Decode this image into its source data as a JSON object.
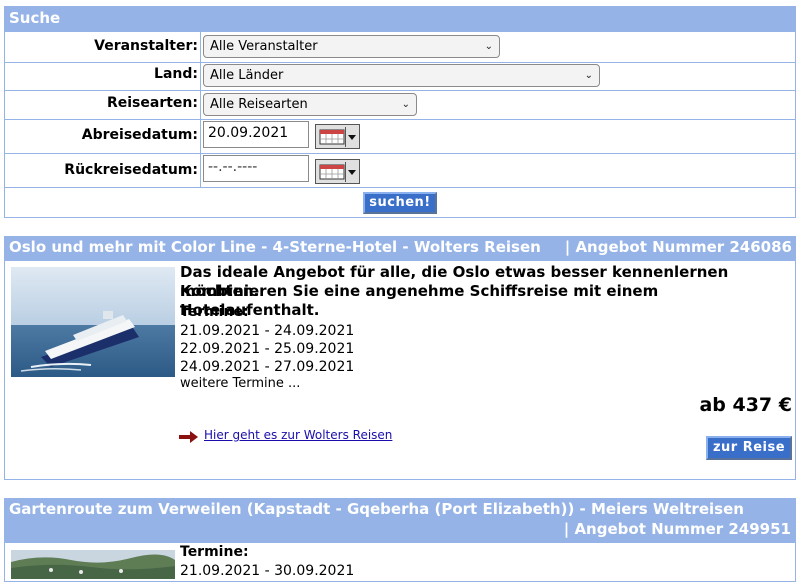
{
  "search": {
    "header": "Suche",
    "veranstalter_label": "Veranstalter:",
    "veranstalter_value": "Alle Veranstalter",
    "land_label": "Land:",
    "land_value": "Alle Länder",
    "reisearten_label": "Reisearten:",
    "reisearten_value": "Alle Reisearten",
    "abreise_label": "Abreisedatum:",
    "abreise_value": "20.09.2021",
    "rueckreise_label": "Rückreisedatum:",
    "rueckreise_value": "--.--.----",
    "submit_label": "suchen!"
  },
  "offers": [
    {
      "title": "Oslo und mehr mit Color Line - 4-Sterne-Hotel - Wolters Reisen",
      "number": "| Angebot Nummer 246086",
      "description_1": "Das ideale Angebot für alle, die Oslo etwas besser kennenlernen möchten.",
      "description_2": "Kombinieren Sie eine angenehme Schiffsreise mit einem Hotelaufenthalt.",
      "termine_label": "Termine:",
      "dates": [
        "21.09.2021 - 24.09.2021",
        "22.09.2021 - 25.09.2021",
        "24.09.2021 - 27.09.2021"
      ],
      "more_dates": "weitere Termine ...",
      "price": "ab 437 €",
      "link_text": "Hier geht es zur Wolters Reisen",
      "button_label": "zur Reise",
      "image_name": "ship-photo"
    },
    {
      "title": "Gartenroute zum Verweilen (Kapstadt - Gqeberha (Port Elizabeth)) - Meiers Weltreisen",
      "number": "| Angebot Nummer 249951",
      "termine_label": "Termine:",
      "dates": [
        "21.09.2021 - 30.09.2021"
      ],
      "image_name": "coast-photo"
    }
  ],
  "colors": {
    "header_bg": "#95b3e6",
    "button_bg": "#3a6fc9",
    "link": "#1a0dab",
    "arrow": "#8b1010"
  }
}
